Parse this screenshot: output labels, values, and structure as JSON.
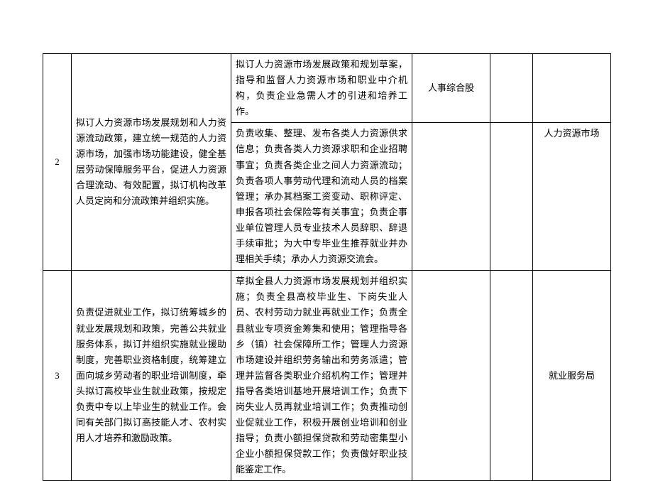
{
  "rows": {
    "r2": {
      "num": "2",
      "left": "拟订人力资源市场发展规划和人力资源流动政策，建立统一规范的人力资源市场，加强市场功能建设，健全基层劳动保障服务平台，促进人力资源合理流动、有效配置，拟订机构改革人员定岗和分流政策并组织实施。",
      "mid1": "拟订人力资源市场发展政策和规划草案，指导和监督人力资源市场和职业中介机构，负责企业急需人才的引进和培养工作。",
      "dept1": "人事综合股",
      "mid2": "负责收集、整理、发布各类人力资源供求信息；负责各类人力资源求职和企业招聘事宜；负责各类企业之间人力资源流动；负责各项人事劳动代理和流动人员的档案管理；承办其档案工资变动、职称评定、申报各项社会保险等有关事宜；负责企事业单位管理人员专业技术人员辞职、辞退手续审批；为大中专毕业生推荐就业并办理相关手续；承办人力资源交流会。",
      "ext2": "人力资源市场"
    },
    "r3": {
      "num": "3",
      "left": "负责促进就业工作，拟订统筹城乡的就业发展规划和政策，完善公共就业服务体系，拟订并组织实施就业援助制度，完善职业资格制度，统筹建立面向城乡劳动者的职业培训制度，牵头拟订高校毕业生就业政策，按规定负责中专以上毕业生的就业工作。会同有关部门拟订高技能人才、农村实用人才培养和激励政策。",
      "mid": "草拟全县人力资源市场发展规划并组织实施；负责全县高校毕业生、下岗失业人员、农村劳动力就业再就业工作；负责全县就业专项资金筹集和使用；管理指导各乡（镇）社会保障所工作；管理人力资源市场建设并组织劳务输出和劳务派遣；管理并监督各类职业介绍机构工作；管理并指导各类培训基地开展培训工作；负责下岗失业人员再就业培训工作；负责推动创业促就业工作，积极开展创业培训和创业指导；负责小额担保贷款和劳动密集型小企业小额担保贷款工作；负责做好职业技能鉴定工作。",
      "dept": "",
      "ext2": "就业服务局"
    }
  }
}
